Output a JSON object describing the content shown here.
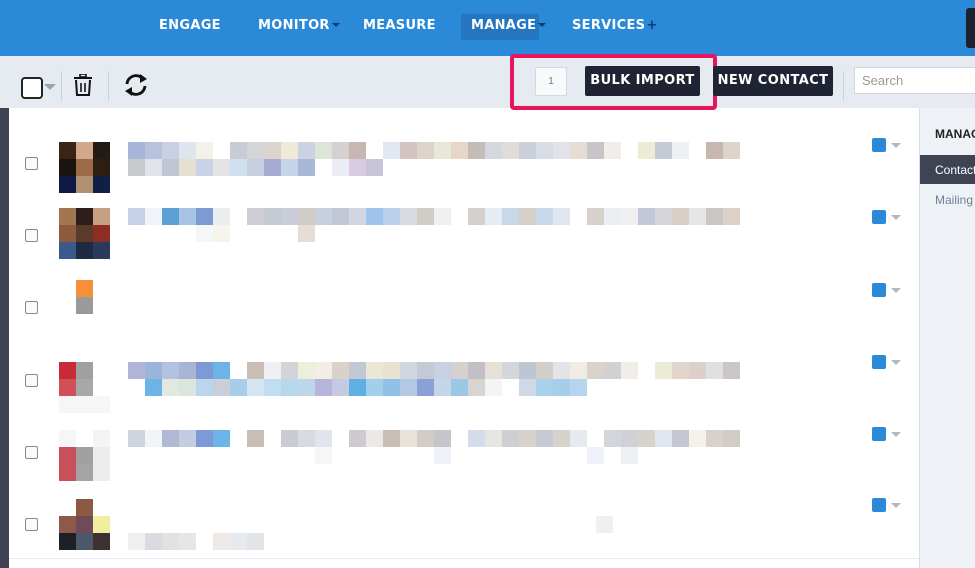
{
  "nav": {
    "items": [
      {
        "label": "ENGAGE"
      },
      {
        "label": "MONITOR"
      },
      {
        "label": "MEASURE"
      },
      {
        "label": "MANAGE"
      },
      {
        "label": "SERVICES"
      }
    ],
    "services_plus": "+"
  },
  "toolbar": {
    "page_number": "1",
    "bulk_import_label": "BULK IMPORT",
    "new_contact_label": "NEW CONTACT",
    "search_placeholder": "Search"
  },
  "right_panel": {
    "title": "MANAG",
    "active_item": "Contact",
    "link_item": "Mailing"
  },
  "colors": {
    "nav_blue": "#2b8ad8",
    "highlight": "#e8145e",
    "dark_button": "#1f2333",
    "twitter_blue": "#2b8ad8"
  },
  "icons": [
    "select-all-checkbox",
    "trash-icon",
    "refresh-icon",
    "twitter-icon",
    "chevron-down-icon"
  ],
  "contacts": [
    {
      "network": "twitter"
    },
    {
      "network": "twitter"
    },
    {
      "network": "twitter"
    },
    {
      "network": "twitter"
    },
    {
      "network": "twitter"
    },
    {
      "network": "twitter"
    }
  ]
}
